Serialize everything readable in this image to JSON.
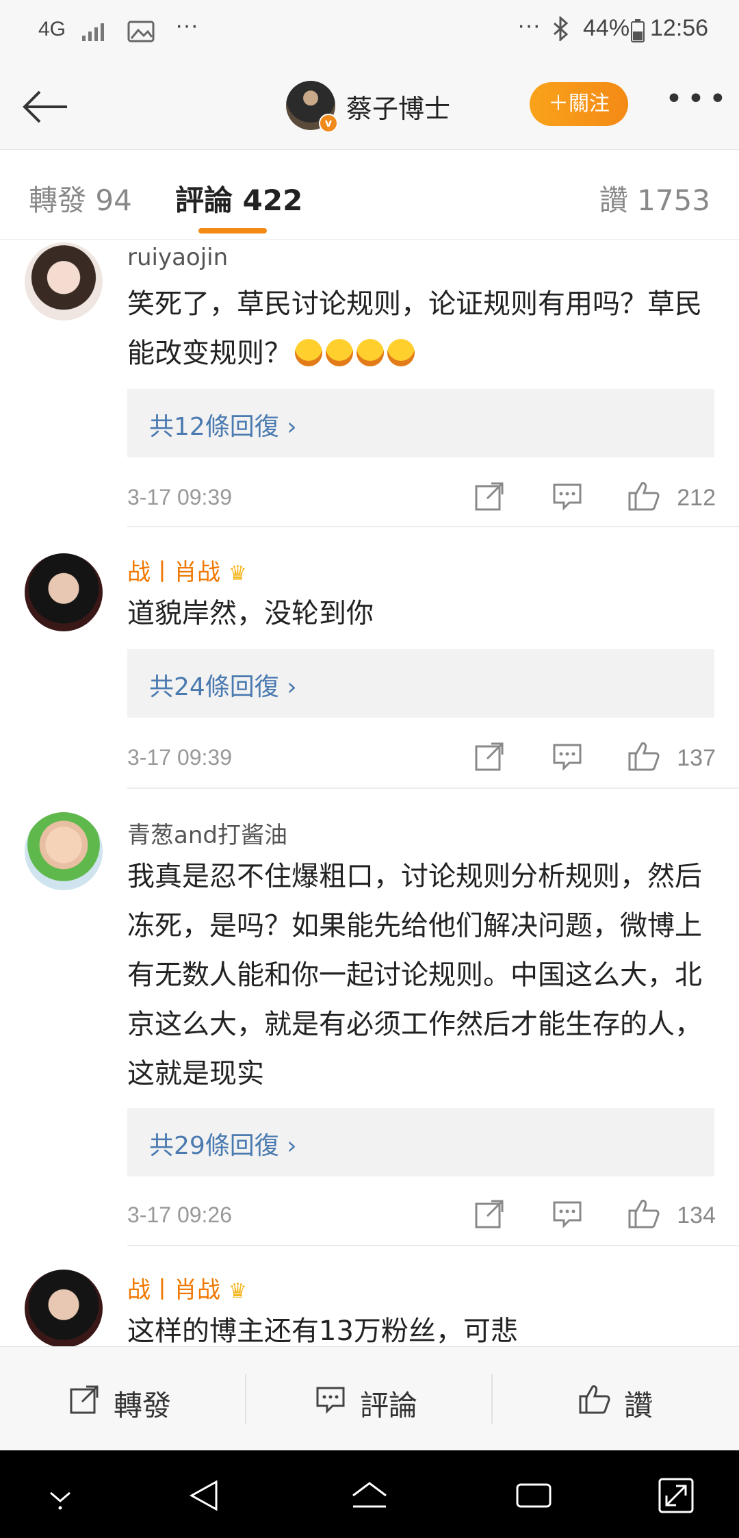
{
  "status_bar": {
    "network": "4G",
    "battery": "44%",
    "time": "12:56"
  },
  "nav": {
    "title": "蔡子博士",
    "follow_label": "＋關注",
    "verified": "v"
  },
  "tabs": {
    "reposts": "轉發 94",
    "comments": "評論 422",
    "likes": "讚 1753"
  },
  "comments": [
    {
      "user": "ruiyaojin",
      "text": "笑死了，草民讨论规则，论证规则有用吗？草民能改变规则？",
      "emoji_count": 4,
      "replies": "共12條回復",
      "time": "3-17 09:39",
      "likes": "212"
    },
    {
      "user": "战丨肖战",
      "text": "道貌岸然，没轮到你",
      "replies": "共24條回復",
      "time": "3-17 09:39",
      "likes": "137"
    },
    {
      "user": "青葱and打酱油",
      "text": "我真是忍不住爆粗口，讨论规则分析规则，然后冻死，是吗？如果能先给他们解决问题，微博上有无数人能和你一起讨论规则。中国这么大，北京这么大，就是有必须工作然后才能生存的人，这就是现实",
      "replies": "共29條回復",
      "time": "3-17 09:26",
      "likes": "134"
    },
    {
      "user": "战丨肖战",
      "text": "这样的博主还有13万粉丝，可悲"
    }
  ],
  "bottom_bar": {
    "repost": "轉發",
    "comment": "評論",
    "like": "讚"
  },
  "colors": {
    "accent": "#f48a16",
    "link": "#4a7ab0",
    "vip_name": "#f07800"
  }
}
